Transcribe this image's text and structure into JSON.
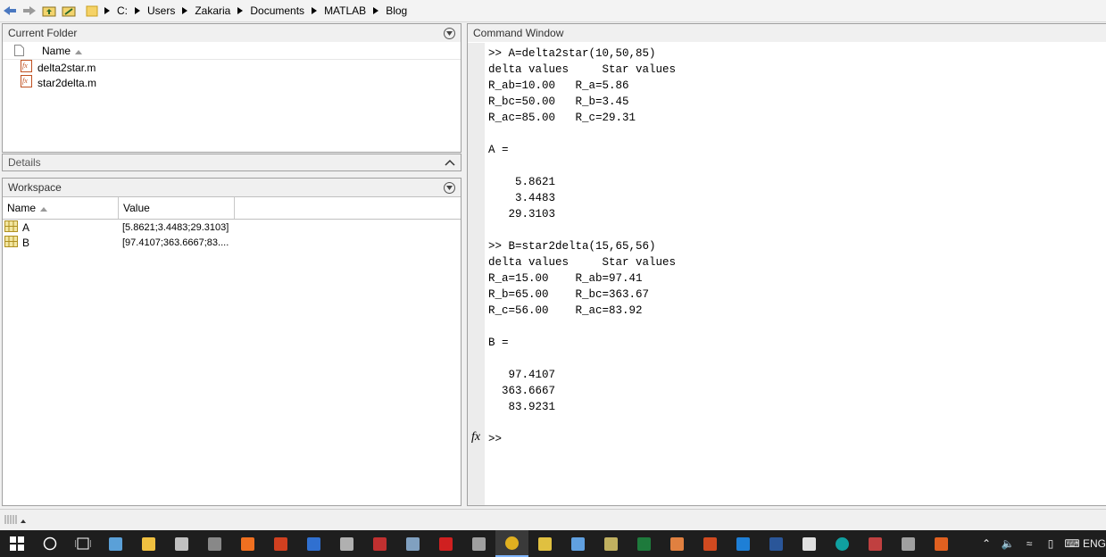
{
  "breadcrumb": [
    "C:",
    "Users",
    "Zakaria",
    "Documents",
    "MATLAB",
    "Blog"
  ],
  "current_folder": {
    "title": "Current Folder",
    "name_header": "Name",
    "files": [
      "delta2star.m",
      "star2delta.m"
    ]
  },
  "details": {
    "title": "Details"
  },
  "workspace": {
    "title": "Workspace",
    "columns": [
      "Name",
      "Value"
    ],
    "rows": [
      {
        "name": "A",
        "value": "[5.8621;3.4483;29.3103]"
      },
      {
        "name": "B",
        "value": "[97.4107;363.6667;83...."
      }
    ]
  },
  "command_window": {
    "title": "Command Window",
    "lines": [
      ">> A=delta2star(10,50,85)",
      "delta values     Star values",
      "R_ab=10.00   R_a=5.86",
      "R_bc=50.00   R_b=3.45",
      "R_ac=85.00   R_c=29.31",
      "",
      "A =",
      "",
      "    5.8621",
      "    3.4483",
      "   29.3103",
      "",
      ">> B=star2delta(15,65,56)",
      "delta values     Star values",
      "R_a=15.00    R_ab=97.41",
      "R_b=65.00    R_bc=363.67",
      "R_c=56.00    R_ac=83.92",
      "",
      "B =",
      "",
      "   97.4107",
      "  363.6667",
      "   83.9231",
      "",
      ">>"
    ],
    "fx_label": "fx"
  },
  "taskbar": {
    "apps": [
      {
        "icon": "app-icon-1",
        "color": "#5aa0d8"
      },
      {
        "icon": "file-explorer-icon",
        "color": "#f0c040"
      },
      {
        "icon": "app-icon-3",
        "color": "#c0c0c0"
      },
      {
        "icon": "app-icon-4",
        "color": "#888888"
      },
      {
        "icon": "app-icon-5",
        "color": "#f07020"
      },
      {
        "icon": "app-icon-6",
        "color": "#d04020"
      },
      {
        "icon": "app-icon-7",
        "color": "#3070d0"
      },
      {
        "icon": "calculator-icon",
        "color": "#b0b0b0"
      },
      {
        "icon": "app-icon-9",
        "color": "#c03030"
      },
      {
        "icon": "app-icon-10",
        "color": "#80a0c0"
      },
      {
        "icon": "acrobat-icon",
        "color": "#d02020"
      },
      {
        "icon": "app-icon-12",
        "color": "#a0a0a0"
      },
      {
        "icon": "chrome-icon",
        "color": "#e0b020"
      },
      {
        "icon": "app-icon-14",
        "color": "#e0c040"
      },
      {
        "icon": "app-icon-15",
        "color": "#60a0e0"
      },
      {
        "icon": "app-icon-16",
        "color": "#c0b060"
      },
      {
        "icon": "excel-icon",
        "color": "#1e7a3c"
      },
      {
        "icon": "app-icon-18",
        "color": "#e08040"
      },
      {
        "icon": "powerpoint-icon",
        "color": "#d04a20"
      },
      {
        "icon": "edge-icon",
        "color": "#1e7fd6"
      },
      {
        "icon": "word-icon",
        "color": "#2a5699"
      },
      {
        "icon": "mail-icon",
        "color": "#e0e0e0"
      },
      {
        "icon": "arduino-icon",
        "color": "#10a0a0"
      },
      {
        "icon": "app-icon-24",
        "color": "#c04040"
      },
      {
        "icon": "app-icon-25",
        "color": "#a0a0a0"
      },
      {
        "icon": "matlab-icon",
        "color": "#e06020"
      }
    ],
    "language": "ENG"
  }
}
